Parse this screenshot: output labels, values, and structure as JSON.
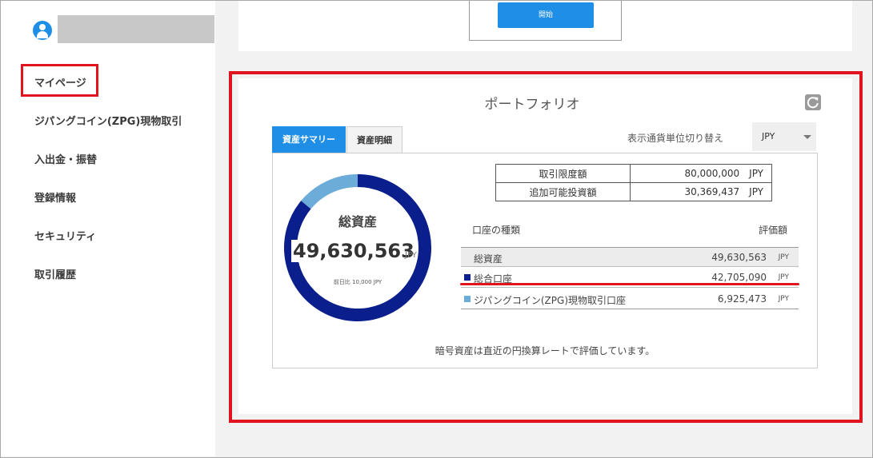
{
  "sidebar": {
    "items": [
      {
        "label": "マイページ"
      },
      {
        "label": "ジパングコイン(ZPG)現物取引"
      },
      {
        "label": "入出金・振替"
      },
      {
        "label": "登録情報"
      },
      {
        "label": "セキュリティ"
      },
      {
        "label": "取引履歴"
      }
    ]
  },
  "top": {
    "start_label": "開始"
  },
  "portfolio": {
    "title": "ポートフォリオ",
    "tabs": [
      {
        "label": "資産サマリー",
        "active": true
      },
      {
        "label": "資産明細",
        "active": false
      }
    ],
    "currency_label": "表示通貨単位切り替え",
    "currency_value": "JPY",
    "donut": {
      "label": "総資産",
      "value": "49,630,563",
      "unit": "JPY",
      "prev_day": "前日比 10,000 JPY"
    },
    "limits": [
      {
        "label": "取引限度額",
        "value": "80,000,000",
        "unit": "JPY"
      },
      {
        "label": "追加可能投資額",
        "value": "30,369,437",
        "unit": "JPY"
      }
    ],
    "accounts_header": {
      "type": "口座の種類",
      "value": "評価額"
    },
    "accounts": [
      {
        "name": "総資産",
        "amount": "49,630,563",
        "unit": "JPY"
      },
      {
        "name": "総合口座",
        "amount": "42,705,090",
        "unit": "JPY",
        "color": "#0a1e8c"
      },
      {
        "name": "ジパングコイン(ZPG)現物取引口座",
        "amount": "6,925,473",
        "unit": "JPY",
        "color": "#6cacd9"
      }
    ],
    "footnote": "暗号資産は直近の円換算レートで評価しています。"
  },
  "colors": {
    "accent": "#1e8ee6",
    "highlight": "#e0141e",
    "donut_main": "#0a1e8c",
    "donut_secondary": "#6cacd9"
  },
  "chart_data": {
    "type": "pie",
    "categories": [
      "総合口座",
      "ジパングコイン(ZPG)現物取引口座"
    ],
    "values": [
      42705090,
      6925473
    ]
  }
}
